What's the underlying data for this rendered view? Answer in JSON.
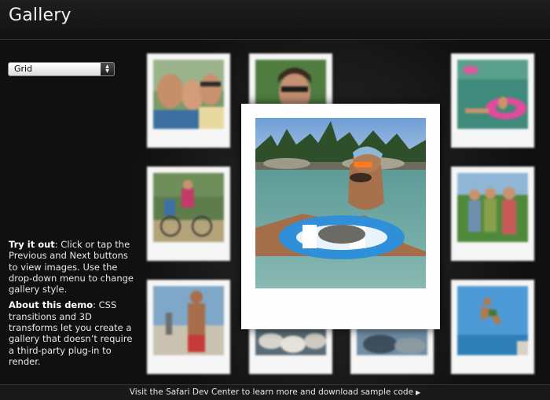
{
  "header": {
    "title": "Gallery"
  },
  "style_select": {
    "selected": "Grid",
    "arrows": "▲▼"
  },
  "info": {
    "try_heading": "Try it out",
    "try_text": ": Click or tap the Previous and Next buttons to view images. Use the drop-down menu to change gallery style.",
    "about_heading": "About this demo",
    "about_text": ": CSS transitions and 3D transforms let you create a gallery that doesn’t require a third-party plug-in to render."
  },
  "footer": {
    "link_text": "Visit the Safari Dev Center to learn more and download sample code",
    "arrow": "▶"
  },
  "photos": [
    {
      "subject": "friends-selfie"
    },
    {
      "subject": "woman-sunglasses"
    },
    {
      "subject": "lake-tube"
    },
    {
      "subject": "cyclists"
    },
    {
      "subject": "family-group"
    },
    {
      "subject": "man-beach"
    },
    {
      "subject": "rocks"
    },
    {
      "subject": "jumping-swimmer"
    }
  ],
  "colors": {
    "background": "#0c0c0c",
    "frame": "#f6f6f6"
  }
}
